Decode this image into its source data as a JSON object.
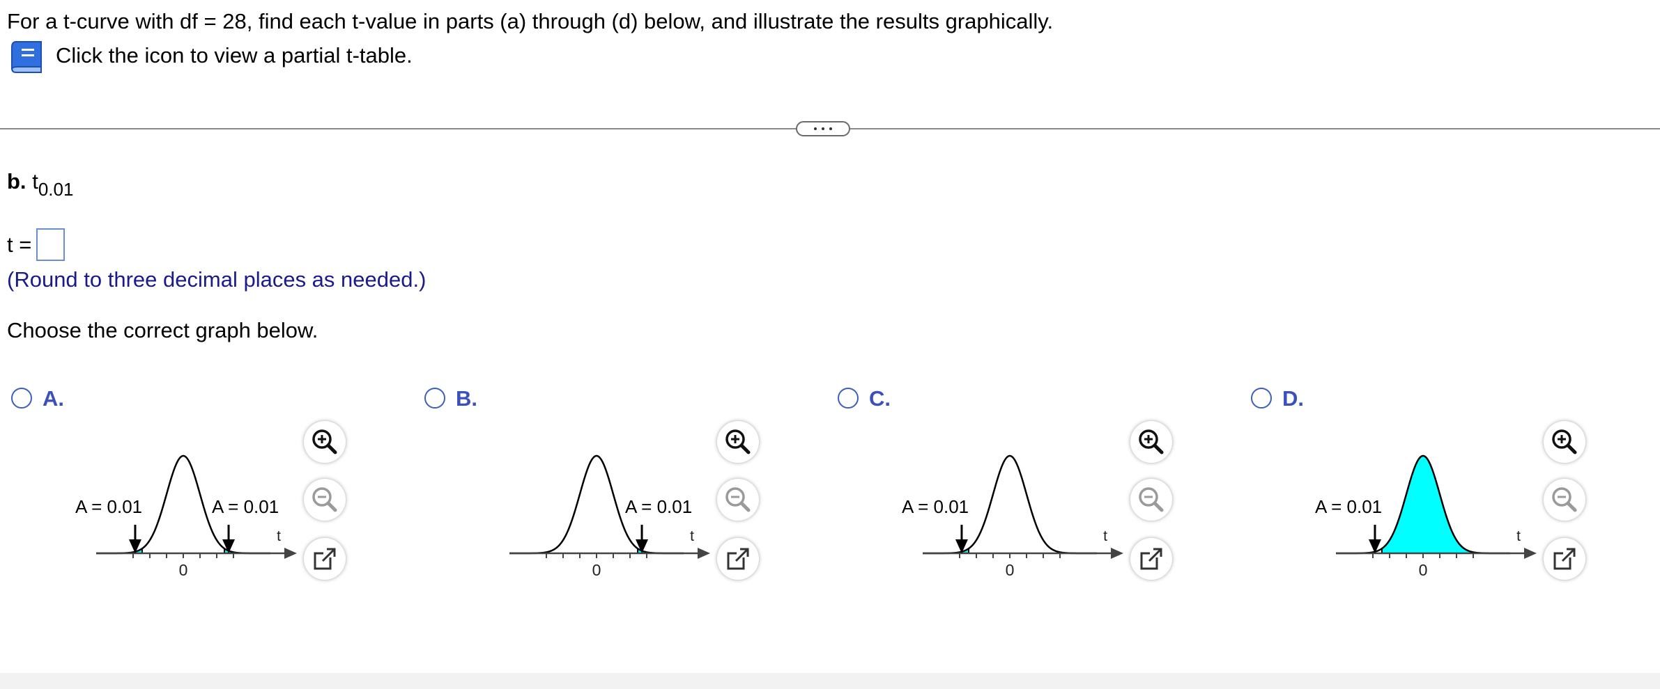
{
  "question": {
    "intro": "For a t-curve with df = 28, find each t-value in parts (a) through (d) below, and illustrate the results graphically.",
    "table_link": "Click the icon to view a partial t-table."
  },
  "part": {
    "letter": "b.",
    "symbol": "t",
    "subscript": "0.01",
    "answer_label": "t =",
    "answer_value": "",
    "hint": "(Round to three decimal places as needed.)",
    "choose": "Choose the correct graph below."
  },
  "colors": {
    "shade": "#00ffff",
    "accent": "#3a50bd",
    "hint": "#1a1a8c"
  },
  "icons": {
    "table": "book-icon",
    "zoom_in": "zoom-in-icon",
    "zoom_out": "zoom-out-icon",
    "popout": "popout-icon"
  },
  "options": [
    {
      "letter": "A.",
      "shade": "both-tails",
      "left_area_label": "A = 0.01",
      "right_area_label": "A = 0.01",
      "axis_label": "t",
      "center_tick": "0"
    },
    {
      "letter": "B.",
      "shade": "right-tail",
      "left_area_label": "",
      "right_area_label": "A = 0.01",
      "axis_label": "t",
      "center_tick": "0"
    },
    {
      "letter": "C.",
      "shade": "left-tail",
      "left_area_label": "A = 0.01",
      "right_area_label": "",
      "axis_label": "t",
      "center_tick": "0"
    },
    {
      "letter": "D.",
      "shade": "above-left-cut",
      "left_area_label": "A = 0.01",
      "right_area_label": "",
      "axis_label": "t",
      "center_tick": "0"
    }
  ]
}
